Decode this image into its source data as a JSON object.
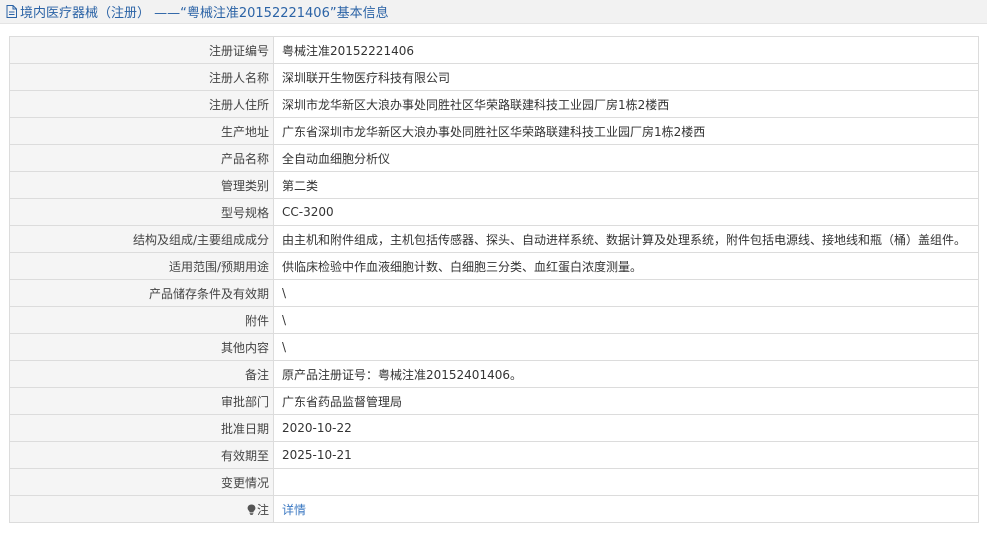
{
  "header": {
    "title": "境内医疗器械（注册） ——“粤械注准20152221406”基本信息"
  },
  "rows": [
    {
      "label": "注册证编号",
      "value": "粤械注准20152221406"
    },
    {
      "label": "注册人名称",
      "value": "深圳联开生物医疗科技有限公司"
    },
    {
      "label": "注册人住所",
      "value": "深圳市龙华新区大浪办事处同胜社区华荣路联建科技工业园厂房1栋2楼西"
    },
    {
      "label": "生产地址",
      "value": "广东省深圳市龙华新区大浪办事处同胜社区华荣路联建科技工业园厂房1栋2楼西"
    },
    {
      "label": "产品名称",
      "value": "全自动血细胞分析仪"
    },
    {
      "label": "管理类别",
      "value": "第二类"
    },
    {
      "label": "型号规格",
      "value": "CC-3200"
    },
    {
      "label": "结构及组成/主要组成成分",
      "value": "由主机和附件组成，主机包括传感器、探头、自动进样系统、数据计算及处理系统，附件包括电源线、接地线和瓶（桶）盖组件。"
    },
    {
      "label": "适用范围/预期用途",
      "value": "供临床检验中作血液细胞计数、白细胞三分类、血红蛋白浓度测量。"
    },
    {
      "label": "产品储存条件及有效期",
      "value": "\\"
    },
    {
      "label": "附件",
      "value": "\\"
    },
    {
      "label": "其他内容",
      "value": "\\"
    },
    {
      "label": "备注",
      "value": "原产品注册证号：粤械注准20152401406。"
    },
    {
      "label": "审批部门",
      "value": "广东省药品监督管理局"
    },
    {
      "label": "批准日期",
      "value": "2020-10-22"
    },
    {
      "label": "有效期至",
      "value": "2025-10-21"
    },
    {
      "label": "变更情况",
      "value": ""
    }
  ],
  "note": {
    "label": "注",
    "link_text": "详情",
    "icon": "lightbulb-icon"
  },
  "colors": {
    "link": "#3b78c2",
    "header_title": "#2b63a6",
    "label_bg": "#f5f5f5",
    "border": "#dcdcdc"
  }
}
